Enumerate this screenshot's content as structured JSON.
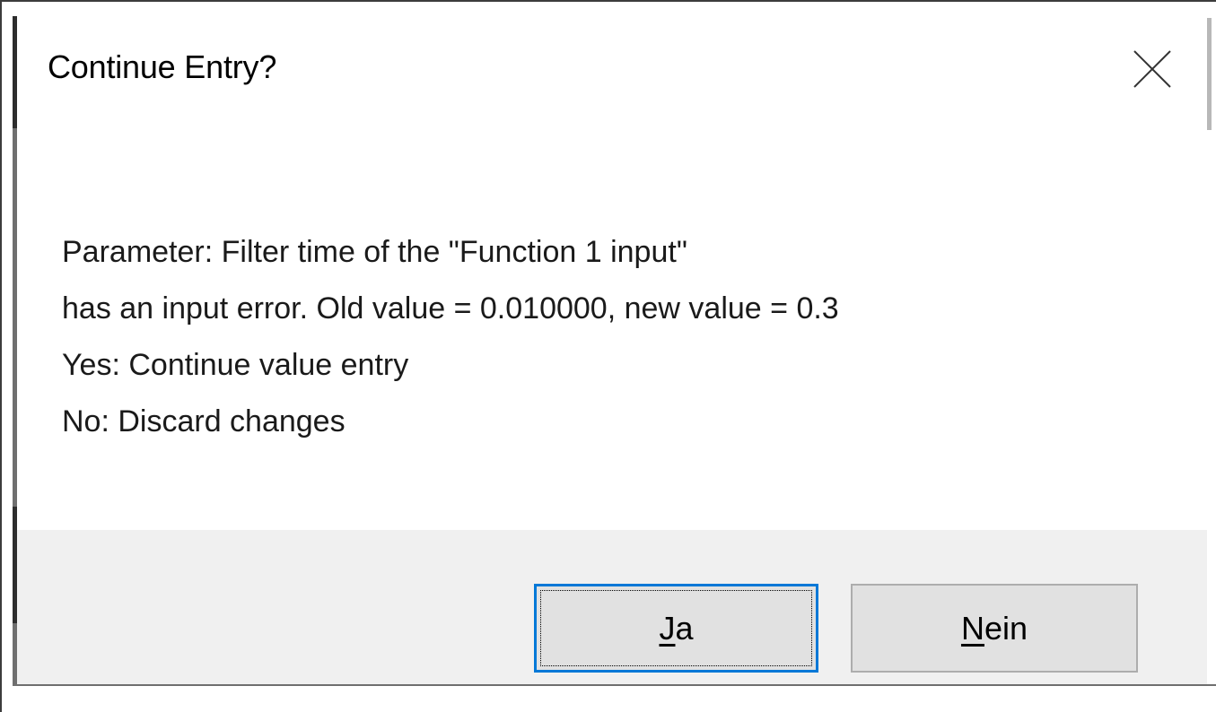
{
  "dialog": {
    "title": "Continue Entry?",
    "close_icon": "close-icon",
    "message_lines": [
      "Parameter: Filter time of the \"Function 1 input\"",
      "has an input error. Old value = 0.010000, new value = 0.3",
      "Yes: Continue value entry",
      "No: Discard changes"
    ],
    "buttons": {
      "yes": {
        "mnemonic": "J",
        "rest": "a"
      },
      "no": {
        "mnemonic": "N",
        "rest": "ein"
      }
    }
  },
  "colors": {
    "footer_background": "#f0f0f0",
    "button_background": "#e1e1e1",
    "default_button_border": "#0078d7"
  }
}
